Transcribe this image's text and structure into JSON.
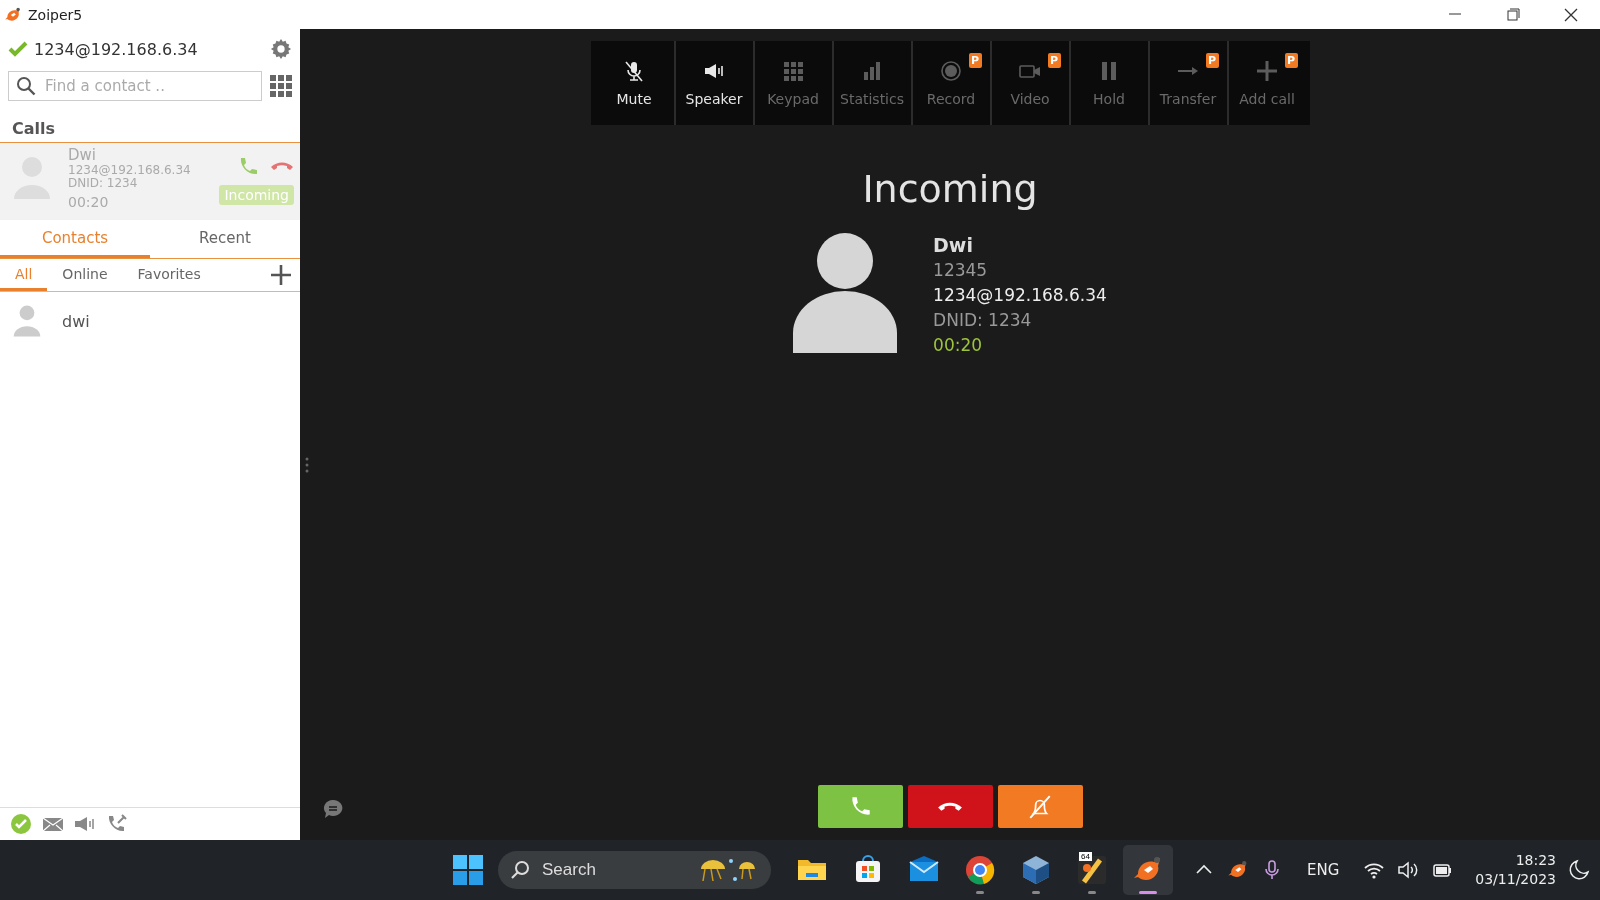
{
  "window": {
    "title": "Zoiper5"
  },
  "account": {
    "address": "1234@192.168.6.34",
    "registered": true
  },
  "search": {
    "placeholder": "Find a contact .."
  },
  "calls_heading": "Calls",
  "calls": [
    {
      "name": "Dwi",
      "address": "1234@192.168.6.34",
      "dnid": "DNID: 1234",
      "duration": "00:20",
      "status": "Incoming"
    }
  ],
  "tabs": [
    {
      "label": "Contacts",
      "selected": true
    },
    {
      "label": "Recent",
      "selected": false
    }
  ],
  "filters": [
    {
      "label": "All",
      "selected": true
    },
    {
      "label": "Online",
      "selected": false
    },
    {
      "label": "Favorites",
      "selected": false
    }
  ],
  "contacts": [
    {
      "name": "dwi"
    }
  ],
  "toolbar": [
    {
      "kind": "mute",
      "label": "Mute",
      "disabled": false
    },
    {
      "kind": "speaker",
      "label": "Speaker",
      "disabled": false
    },
    {
      "kind": "keypad",
      "label": "Keypad",
      "disabled": true
    },
    {
      "kind": "statistics",
      "label": "Statistics",
      "disabled": true
    },
    {
      "kind": "record",
      "label": "Record",
      "disabled": true,
      "badge": "P"
    },
    {
      "kind": "video",
      "label": "Video",
      "disabled": true,
      "badge": "P"
    },
    {
      "kind": "hold",
      "label": "Hold",
      "disabled": true
    },
    {
      "kind": "transfer",
      "label": "Transfer",
      "disabled": true,
      "badge": "P"
    },
    {
      "kind": "add",
      "label": "Add call",
      "disabled": true,
      "badge": "P"
    }
  ],
  "call": {
    "heading": "Incoming",
    "name": "Dwi",
    "number": "12345",
    "address": "1234@192.168.6.34",
    "dnid": "DNID: 1234",
    "duration": "00:20"
  },
  "actions": [
    {
      "kind": "answer"
    },
    {
      "kind": "hangup"
    },
    {
      "kind": "silence"
    }
  ],
  "taskbar": {
    "search_label": "Search",
    "apps": [
      {
        "kind": "files",
        "running": false,
        "selected": false
      },
      {
        "kind": "store",
        "running": false,
        "selected": false
      },
      {
        "kind": "mail",
        "running": false,
        "selected": false
      },
      {
        "kind": "browser",
        "running": true,
        "selected": false
      },
      {
        "kind": "cube",
        "running": true,
        "selected": false
      },
      {
        "kind": "app64",
        "badge": "64",
        "running": true,
        "selected": false
      },
      {
        "kind": "phone",
        "running": true,
        "selected": true
      }
    ],
    "language": "ENG",
    "time": "18:23",
    "date": "03/11/2023"
  }
}
